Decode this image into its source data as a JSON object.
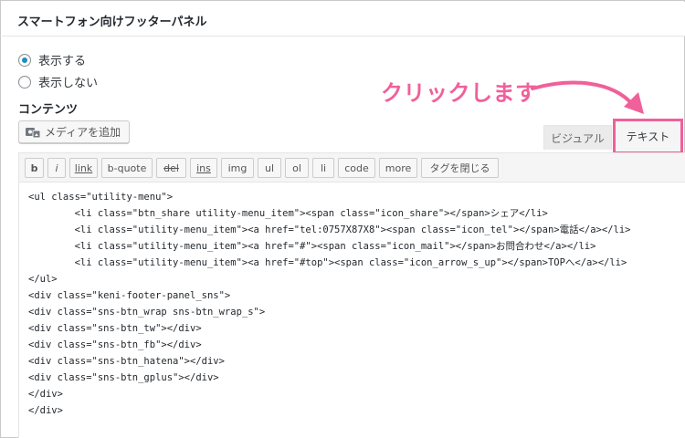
{
  "panel": {
    "title": "スマートフォン向けフッターパネル"
  },
  "display_options": [
    {
      "label": "表示する",
      "checked": true
    },
    {
      "label": "表示しない",
      "checked": false
    }
  ],
  "contents_label": "コンテンツ",
  "annotation": {
    "text": "クリックします",
    "color": "#f0609a"
  },
  "media_button": {
    "label": "メディアを追加",
    "icon": "media-icon"
  },
  "editor_tabs": {
    "visual": "ビジュアル",
    "text": "テキスト",
    "highlight_color": "#f0609a"
  },
  "quicktags": [
    "b",
    "i",
    "link",
    "b-quote",
    "del",
    "ins",
    "img",
    "ul",
    "ol",
    "li",
    "code",
    "more",
    "タグを閉じる"
  ],
  "code_lines": [
    "<ul class=\"utility-menu\">",
    "        <li class=\"btn_share utility-menu_item\"><span class=\"icon_share\"></span>シェア</li>",
    "        <li class=\"utility-menu_item\"><a href=\"tel:0757X87X8\"><span class=\"icon_tel\"></span>電話</a></li>",
    "        <li class=\"utility-menu_item\"><a href=\"#\"><span class=\"icon_mail\"></span>お問合わせ</a></li>",
    "        <li class=\"utility-menu_item\"><a href=\"#top\"><span class=\"icon_arrow_s_up\"></span>TOPへ</a></li>",
    "</ul>",
    "<div class=\"keni-footer-panel_sns\">",
    "<div class=\"sns-btn_wrap sns-btn_wrap_s\">",
    "<div class=\"sns-btn_tw\"></div>",
    "<div class=\"sns-btn_fb\"></div>",
    "<div class=\"sns-btn_hatena\"></div>",
    "<div class=\"sns-btn_gplus\"></div>",
    "</div>",
    "</div>"
  ]
}
